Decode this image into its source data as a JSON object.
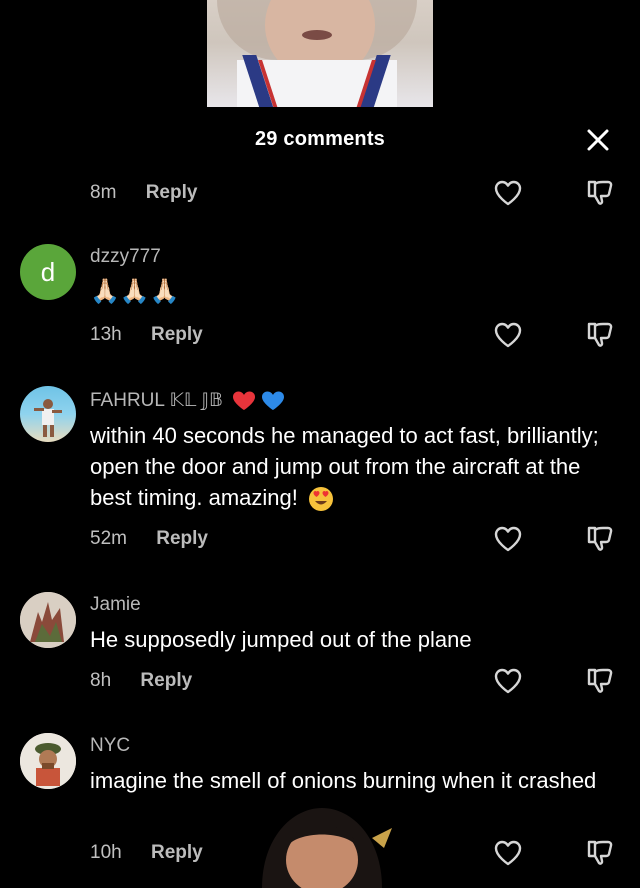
{
  "header": {
    "title": "29 comments"
  },
  "comments": [
    {
      "time": "8m",
      "reply": "Reply"
    },
    {
      "avatar_letter": "d",
      "username": "dzzy777",
      "text": "🙏🏻🙏🏻🙏🏻",
      "time": "13h",
      "reply": "Reply"
    },
    {
      "username": "FAHRUL 𝕂𝕃 𝕁𝔹",
      "text": "within 40 seconds he managed to act fast, brilliantly; open the door and jump out from the aircraft at the best timing. amazing!",
      "time": "52m",
      "reply": "Reply"
    },
    {
      "username": "Jamie",
      "text": "He supposedly jumped out of the plane",
      "time": "8h",
      "reply": "Reply"
    },
    {
      "username": "NYC",
      "text": "imagine the smell of onions burning when it crashed",
      "time": "10h",
      "reply": "Reply"
    }
  ],
  "colors": {
    "background": "#000000",
    "avatar_d": "#5aa63a",
    "secondary_text": "#b8b8b8"
  },
  "icons": [
    "close-icon",
    "heart-icon",
    "dislike-icon"
  ]
}
